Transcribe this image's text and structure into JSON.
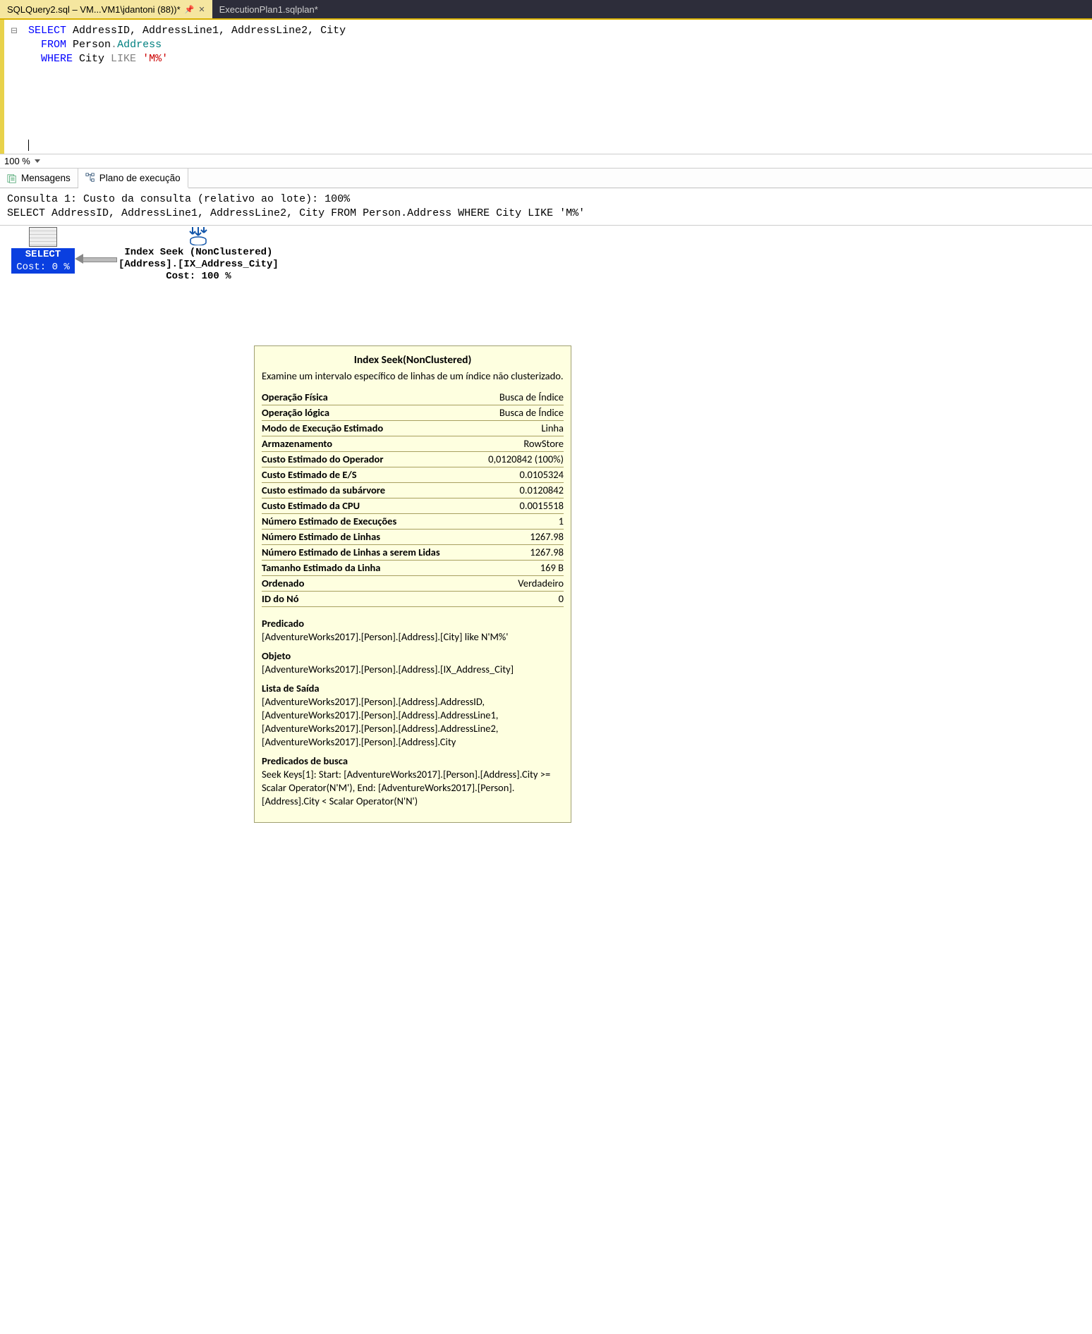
{
  "tabs": {
    "active": "SQLQuery2.sql – VM...VM1\\jdantoni (88))*",
    "pin_glyph": "📌",
    "close_glyph": "✕",
    "inactive": "ExecutionPlan1.sqlplan*"
  },
  "editor": {
    "collapse_glyph": "⊟",
    "line1_select": "SELECT",
    "line1_rest": " AddressID, AddressLine1, AddressLine2, City",
    "line2_from": "FROM",
    "line2_person": " Person",
    "line2_dot": ".",
    "line2_addr": "Address",
    "line3_where": "WHERE",
    "line3_city": " City ",
    "line3_like": "LIKE",
    "line3_str": " 'M%'"
  },
  "zoom": {
    "label": "100 %"
  },
  "result_tabs": {
    "messages": "Mensagens",
    "plan": "Plano de execução"
  },
  "plan_header": {
    "line1": "Consulta 1: Custo da consulta (relativo ao lote): 100%",
    "line2": "SELECT AddressID, AddressLine1, AddressLine2, City FROM Person.Address WHERE City LIKE 'M%'"
  },
  "plan": {
    "select_label": "SELECT",
    "select_cost": "Cost: 0 %",
    "seek_title": "Index Seek (NonClustered)",
    "seek_obj": "[Address].[IX_Address_City]",
    "seek_cost": "Cost: 100 %"
  },
  "tooltip": {
    "title": "Index Seek(NonClustered)",
    "desc": "Examine um intervalo específico de linhas de um índice não clusterizado.",
    "rows": [
      {
        "l": "Operação Física",
        "r": "Busca de Índice"
      },
      {
        "l": "Operação lógica",
        "r": "Busca de Índice"
      },
      {
        "l": "Modo de Execução Estimado",
        "r": "Linha"
      },
      {
        "l": "Armazenamento",
        "r": "RowStore"
      },
      {
        "l": "Custo Estimado do Operador",
        "r": "0,0120842 (100%)"
      },
      {
        "l": "Custo Estimado de E/S",
        "r": "0.0105324"
      },
      {
        "l": "Custo estimado da subárvore",
        "r": "0.0120842"
      },
      {
        "l": "Custo Estimado da CPU",
        "r": "0.0015518"
      },
      {
        "l": "Número Estimado de Execuções",
        "r": "1"
      },
      {
        "l": "Número Estimado de Linhas",
        "r": "1267.98"
      },
      {
        "l": "Número Estimado de Linhas a serem Lidas",
        "r": "1267.98"
      },
      {
        "l": "Tamanho Estimado da Linha",
        "r": "169 B"
      },
      {
        "l": "Ordenado",
        "r": "Verdadeiro"
      },
      {
        "l": "ID do Nó",
        "r": "0"
      }
    ],
    "sec_pred_t": "Predicado",
    "sec_pred_b": "[AdventureWorks2017].[Person].[Address].[City] like N'M%'",
    "sec_obj_t": "Objeto",
    "sec_obj_b": "[AdventureWorks2017].[Person].[Address].[IX_Address_City]",
    "sec_out_t": "Lista de Saída",
    "sec_out_b": "[AdventureWorks2017].[Person].[Address].AddressID, [AdventureWorks2017].[Person].[Address].AddressLine1, [AdventureWorks2017].[Person].[Address].AddressLine2, [AdventureWorks2017].[Person].[Address].City",
    "sec_seek_t": "Predicados de busca",
    "sec_seek_b": "Seek Keys[1]: Start: [AdventureWorks2017].[Person].[Address].City >= Scalar Operator(N'M'), End: [AdventureWorks2017].[Person].[Address].City < Scalar Operator(N'N')"
  }
}
